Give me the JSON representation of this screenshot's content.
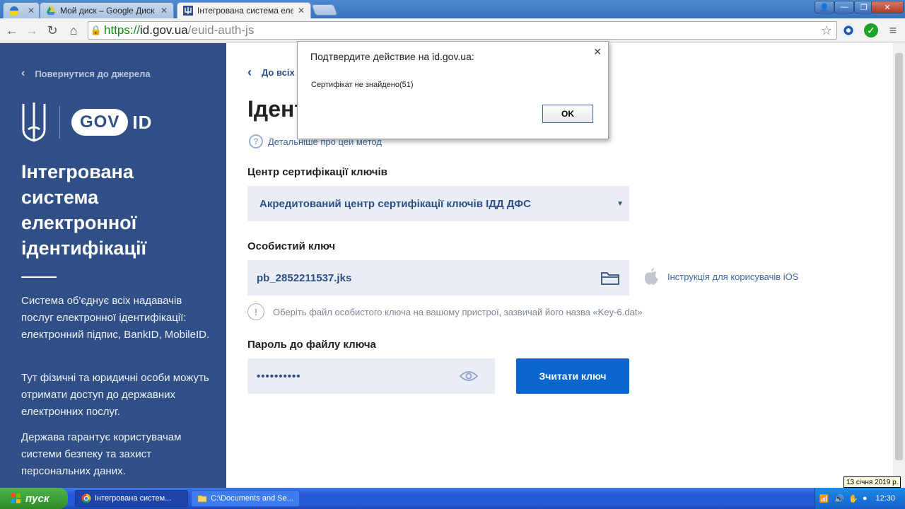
{
  "browser": {
    "tabs": [
      {
        "title": ""
      },
      {
        "title": "Мой диск – Google Диск"
      },
      {
        "title": "Інтегрована система елект"
      }
    ],
    "url": {
      "scheme": "https://",
      "host": "id.gov.ua",
      "path": "/euid-auth-js"
    }
  },
  "sidebar": {
    "back_label": "Повернутися до джерела",
    "logo_gov": "GOV",
    "logo_id": "ID",
    "title": "Інтегрована система електронної ідентифікації",
    "paragraphs": [
      "Система об'єднує всіх надавачів послуг електронної ідентифікації: електронний підпис, BankID, MobileID.",
      "Тут фізичні та юридичні особи можуть отримати доступ до державних електронних послуг.",
      "Держава гарантує користувачам системи безпеку та захист персональних даних."
    ]
  },
  "main": {
    "back_label": "До всіх",
    "title": "Ідент",
    "method_link": "Детальніше про цей метод",
    "ca_label": "Центр сертифікації ключів",
    "ca_value": "Акредитований центр сертифікації ключів ІДД ДФС",
    "key_label": "Особистий ключ",
    "key_file": "pb_2852211537.jks",
    "ios_link": "Інструкція для корисувачів iOS",
    "key_hint": "Оберіть файл особистого ключа на вашому пристрої, зазвичай його назва «Key-6.dat»",
    "password_label": "Пароль до файлу ключа",
    "password_value": "••••••••••",
    "read_button": "Зчитати ключ"
  },
  "dialog": {
    "title": "Подтвердите действие на id.gov.ua:",
    "message": "Сертифікат не знайдено(51)",
    "ok_label": "OK"
  },
  "taskbar": {
    "start_label": "пуск",
    "items": [
      {
        "label": "Інтегрована систем..."
      },
      {
        "label": "C:\\Documents and Se..."
      }
    ],
    "clock": "12:30",
    "date_tooltip": "13 січня 2019 р."
  },
  "colors": {
    "sidebar_bg": "#2f4f86",
    "accent_button": "#0a66cf",
    "field_bg": "#e8edf6"
  }
}
